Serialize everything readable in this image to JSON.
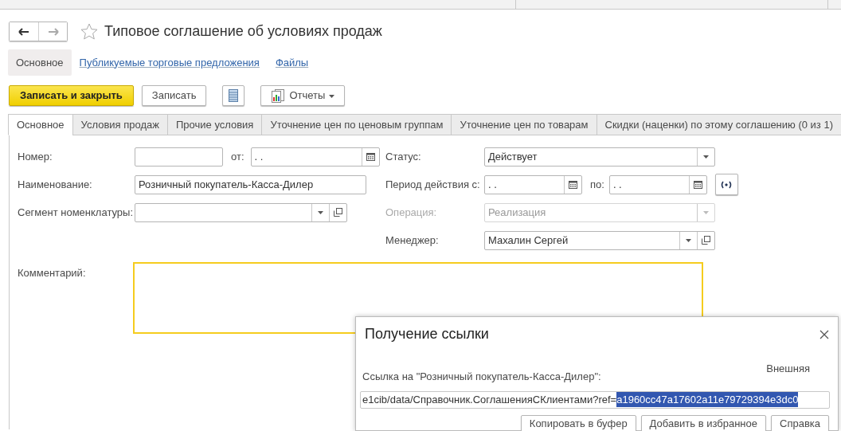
{
  "nav": {
    "back_disabled": false,
    "forward_disabled": true
  },
  "title": "Типовое соглашение об условиях продаж",
  "favorite": false,
  "sections": [
    {
      "label": "Основное",
      "selected": true
    },
    {
      "label": "Публикуемые торговые предложения",
      "selected": false
    },
    {
      "label": "Файлы",
      "selected": false
    }
  ],
  "toolbar": [
    {
      "kind": "primary",
      "label": "Записать и закрыть"
    },
    {
      "kind": "button",
      "label": "Записать"
    },
    {
      "kind": "icon"
    },
    {
      "kind": "menu",
      "label": "Отчеты"
    }
  ],
  "tabs": [
    {
      "label": "Основное",
      "selected": true
    },
    {
      "label": "Условия продаж",
      "selected": false
    },
    {
      "label": "Прочие условия",
      "selected": false
    },
    {
      "label": "Уточнение цен по ценовым группам",
      "selected": false
    },
    {
      "label": "Уточнение цен по товарам",
      "selected": false
    },
    {
      "label": "Скидки (наценки) по этому соглашению (0 из 1)",
      "selected": false
    }
  ],
  "left_fields": [
    {
      "kind": "number_date",
      "label": "Номер:",
      "date_label": "от:",
      "date_value": ".  ."
    },
    {
      "kind": "text",
      "label": "Наименование:",
      "value": "Розничный покупатель-Касса-Дилер"
    },
    {
      "kind": "select_open",
      "label": "Сегмент номенклатуры:"
    }
  ],
  "right_fields": [
    {
      "kind": "select",
      "label": "Статус:",
      "value": "Действует",
      "disabled": false
    },
    {
      "kind": "period",
      "label": "Период действия с:",
      "value": ".  .",
      "to_label": "по:",
      "to_value": ".  ."
    },
    {
      "kind": "select",
      "label": "Операция:",
      "value": "Реализация",
      "disabled": true
    },
    {
      "kind": "select_open",
      "label": "Менеджер:",
      "value": "Махалин Сергей",
      "disabled": false
    }
  ],
  "comment": {
    "label": "Комментарий:",
    "focused": true
  },
  "dialog": {
    "title": "Получение ссылки",
    "label": "Ссылка на \"Розничный покупатель-Касса-Дилер\":",
    "type_label": "Внешняя",
    "url_prefix": "e1cib/data/Справочник.СоглашенияСКлиентами?ref=",
    "url_selected": "a1960cc47a17602a11e79729394e3dc0",
    "buttons": [
      "Копировать в буфер",
      "Добавить в избранное",
      "Справка"
    ]
  }
}
